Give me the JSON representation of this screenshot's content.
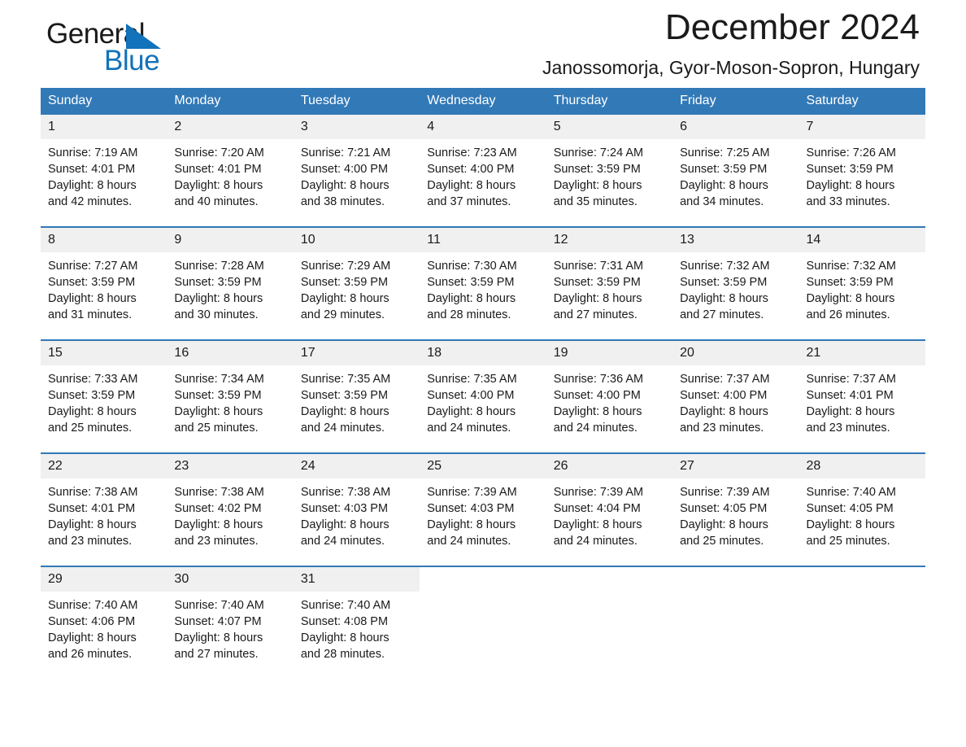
{
  "brand": {
    "name_top": "General",
    "name_bottom": "Blue",
    "accent_color": "#1272ba"
  },
  "header": {
    "title": "December 2024",
    "subtitle": "Janossomorja, Gyor-Moson-Sopron, Hungary"
  },
  "colors": {
    "header_blue": "#3279b7",
    "daynum_gray": "#f0f0f0",
    "text": "#1a1a1a"
  },
  "calendar": {
    "weekday_headers": [
      "Sunday",
      "Monday",
      "Tuesday",
      "Wednesday",
      "Thursday",
      "Friday",
      "Saturday"
    ],
    "weeks": [
      [
        {
          "day": "1",
          "sunrise": "Sunrise: 7:19 AM",
          "sunset": "Sunset: 4:01 PM",
          "daylight_line1": "Daylight: 8 hours",
          "daylight_line2": "and 42 minutes."
        },
        {
          "day": "2",
          "sunrise": "Sunrise: 7:20 AM",
          "sunset": "Sunset: 4:01 PM",
          "daylight_line1": "Daylight: 8 hours",
          "daylight_line2": "and 40 minutes."
        },
        {
          "day": "3",
          "sunrise": "Sunrise: 7:21 AM",
          "sunset": "Sunset: 4:00 PM",
          "daylight_line1": "Daylight: 8 hours",
          "daylight_line2": "and 38 minutes."
        },
        {
          "day": "4",
          "sunrise": "Sunrise: 7:23 AM",
          "sunset": "Sunset: 4:00 PM",
          "daylight_line1": "Daylight: 8 hours",
          "daylight_line2": "and 37 minutes."
        },
        {
          "day": "5",
          "sunrise": "Sunrise: 7:24 AM",
          "sunset": "Sunset: 3:59 PM",
          "daylight_line1": "Daylight: 8 hours",
          "daylight_line2": "and 35 minutes."
        },
        {
          "day": "6",
          "sunrise": "Sunrise: 7:25 AM",
          "sunset": "Sunset: 3:59 PM",
          "daylight_line1": "Daylight: 8 hours",
          "daylight_line2": "and 34 minutes."
        },
        {
          "day": "7",
          "sunrise": "Sunrise: 7:26 AM",
          "sunset": "Sunset: 3:59 PM",
          "daylight_line1": "Daylight: 8 hours",
          "daylight_line2": "and 33 minutes."
        }
      ],
      [
        {
          "day": "8",
          "sunrise": "Sunrise: 7:27 AM",
          "sunset": "Sunset: 3:59 PM",
          "daylight_line1": "Daylight: 8 hours",
          "daylight_line2": "and 31 minutes."
        },
        {
          "day": "9",
          "sunrise": "Sunrise: 7:28 AM",
          "sunset": "Sunset: 3:59 PM",
          "daylight_line1": "Daylight: 8 hours",
          "daylight_line2": "and 30 minutes."
        },
        {
          "day": "10",
          "sunrise": "Sunrise: 7:29 AM",
          "sunset": "Sunset: 3:59 PM",
          "daylight_line1": "Daylight: 8 hours",
          "daylight_line2": "and 29 minutes."
        },
        {
          "day": "11",
          "sunrise": "Sunrise: 7:30 AM",
          "sunset": "Sunset: 3:59 PM",
          "daylight_line1": "Daylight: 8 hours",
          "daylight_line2": "and 28 minutes."
        },
        {
          "day": "12",
          "sunrise": "Sunrise: 7:31 AM",
          "sunset": "Sunset: 3:59 PM",
          "daylight_line1": "Daylight: 8 hours",
          "daylight_line2": "and 27 minutes."
        },
        {
          "day": "13",
          "sunrise": "Sunrise: 7:32 AM",
          "sunset": "Sunset: 3:59 PM",
          "daylight_line1": "Daylight: 8 hours",
          "daylight_line2": "and 27 minutes."
        },
        {
          "day": "14",
          "sunrise": "Sunrise: 7:32 AM",
          "sunset": "Sunset: 3:59 PM",
          "daylight_line1": "Daylight: 8 hours",
          "daylight_line2": "and 26 minutes."
        }
      ],
      [
        {
          "day": "15",
          "sunrise": "Sunrise: 7:33 AM",
          "sunset": "Sunset: 3:59 PM",
          "daylight_line1": "Daylight: 8 hours",
          "daylight_line2": "and 25 minutes."
        },
        {
          "day": "16",
          "sunrise": "Sunrise: 7:34 AM",
          "sunset": "Sunset: 3:59 PM",
          "daylight_line1": "Daylight: 8 hours",
          "daylight_line2": "and 25 minutes."
        },
        {
          "day": "17",
          "sunrise": "Sunrise: 7:35 AM",
          "sunset": "Sunset: 3:59 PM",
          "daylight_line1": "Daylight: 8 hours",
          "daylight_line2": "and 24 minutes."
        },
        {
          "day": "18",
          "sunrise": "Sunrise: 7:35 AM",
          "sunset": "Sunset: 4:00 PM",
          "daylight_line1": "Daylight: 8 hours",
          "daylight_line2": "and 24 minutes."
        },
        {
          "day": "19",
          "sunrise": "Sunrise: 7:36 AM",
          "sunset": "Sunset: 4:00 PM",
          "daylight_line1": "Daylight: 8 hours",
          "daylight_line2": "and 24 minutes."
        },
        {
          "day": "20",
          "sunrise": "Sunrise: 7:37 AM",
          "sunset": "Sunset: 4:00 PM",
          "daylight_line1": "Daylight: 8 hours",
          "daylight_line2": "and 23 minutes."
        },
        {
          "day": "21",
          "sunrise": "Sunrise: 7:37 AM",
          "sunset": "Sunset: 4:01 PM",
          "daylight_line1": "Daylight: 8 hours",
          "daylight_line2": "and 23 minutes."
        }
      ],
      [
        {
          "day": "22",
          "sunrise": "Sunrise: 7:38 AM",
          "sunset": "Sunset: 4:01 PM",
          "daylight_line1": "Daylight: 8 hours",
          "daylight_line2": "and 23 minutes."
        },
        {
          "day": "23",
          "sunrise": "Sunrise: 7:38 AM",
          "sunset": "Sunset: 4:02 PM",
          "daylight_line1": "Daylight: 8 hours",
          "daylight_line2": "and 23 minutes."
        },
        {
          "day": "24",
          "sunrise": "Sunrise: 7:38 AM",
          "sunset": "Sunset: 4:03 PM",
          "daylight_line1": "Daylight: 8 hours",
          "daylight_line2": "and 24 minutes."
        },
        {
          "day": "25",
          "sunrise": "Sunrise: 7:39 AM",
          "sunset": "Sunset: 4:03 PM",
          "daylight_line1": "Daylight: 8 hours",
          "daylight_line2": "and 24 minutes."
        },
        {
          "day": "26",
          "sunrise": "Sunrise: 7:39 AM",
          "sunset": "Sunset: 4:04 PM",
          "daylight_line1": "Daylight: 8 hours",
          "daylight_line2": "and 24 minutes."
        },
        {
          "day": "27",
          "sunrise": "Sunrise: 7:39 AM",
          "sunset": "Sunset: 4:05 PM",
          "daylight_line1": "Daylight: 8 hours",
          "daylight_line2": "and 25 minutes."
        },
        {
          "day": "28",
          "sunrise": "Sunrise: 7:40 AM",
          "sunset": "Sunset: 4:05 PM",
          "daylight_line1": "Daylight: 8 hours",
          "daylight_line2": "and 25 minutes."
        }
      ],
      [
        {
          "day": "29",
          "sunrise": "Sunrise: 7:40 AM",
          "sunset": "Sunset: 4:06 PM",
          "daylight_line1": "Daylight: 8 hours",
          "daylight_line2": "and 26 minutes."
        },
        {
          "day": "30",
          "sunrise": "Sunrise: 7:40 AM",
          "sunset": "Sunset: 4:07 PM",
          "daylight_line1": "Daylight: 8 hours",
          "daylight_line2": "and 27 minutes."
        },
        {
          "day": "31",
          "sunrise": "Sunrise: 7:40 AM",
          "sunset": "Sunset: 4:08 PM",
          "daylight_line1": "Daylight: 8 hours",
          "daylight_line2": "and 28 minutes."
        },
        {
          "day": "",
          "sunrise": "",
          "sunset": "",
          "daylight_line1": "",
          "daylight_line2": ""
        },
        {
          "day": "",
          "sunrise": "",
          "sunset": "",
          "daylight_line1": "",
          "daylight_line2": ""
        },
        {
          "day": "",
          "sunrise": "",
          "sunset": "",
          "daylight_line1": "",
          "daylight_line2": ""
        },
        {
          "day": "",
          "sunrise": "",
          "sunset": "",
          "daylight_line1": "",
          "daylight_line2": ""
        }
      ]
    ]
  }
}
